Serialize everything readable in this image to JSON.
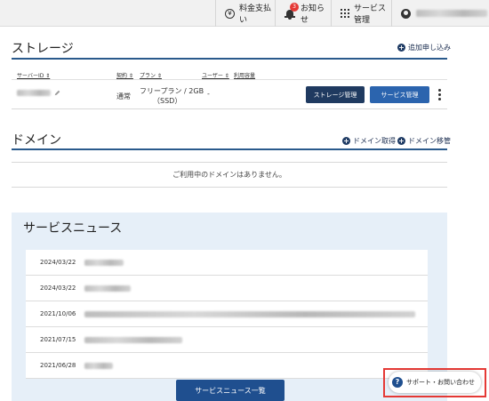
{
  "topbar": {
    "pay_label": "料金支払い",
    "pay_icon": "¥",
    "notice_label": "お知らせ",
    "notice_count": "3",
    "service_label": "サービス管理"
  },
  "storage": {
    "title": "ストレージ",
    "add_label": "追加申し込み",
    "headers": {
      "server_id": "サーバーID ⇕",
      "contract": "契約 ⇕",
      "plan": "プラン ⇕",
      "user": "ユーザー ⇕",
      "usage": "利用容量"
    },
    "row": {
      "contract": "通常",
      "plan_line1": "フリープラン / 2GB",
      "plan_line2": "（SSD）",
      "user": "-"
    },
    "manage_storage_label": "ストレージ管理",
    "manage_service_label": "サービス管理"
  },
  "domain": {
    "title": "ドメイン",
    "acquire_label": "ドメイン取得",
    "transfer_label": "ドメイン移管",
    "empty_message": "ご利用中のドメインはありません。"
  },
  "news": {
    "title": "サービスニュース",
    "dates": [
      "2024/03/22",
      "2024/03/22",
      "2021/10/06",
      "2021/07/15",
      "2021/06/28"
    ],
    "list_button_label": "サービスニュース一覧"
  },
  "support": {
    "label": "サポート・お問い合わせ",
    "icon": "?"
  },
  "colors": {
    "accent_line": "#2a5a8c",
    "dark_button": "#1f3a60",
    "blue_button": "#2b64ae",
    "news_bg": "#e6eff8",
    "highlight": "#e53935"
  }
}
